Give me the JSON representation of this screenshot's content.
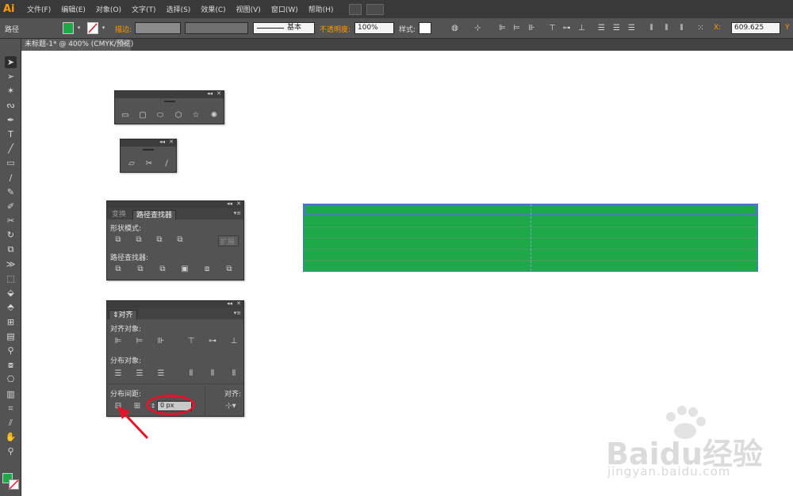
{
  "app": {
    "logo": "Ai"
  },
  "menu": [
    "文件(F)",
    "编辑(E)",
    "对象(O)",
    "文字(T)",
    "选择(S)",
    "效果(C)",
    "视图(V)",
    "窗口(W)",
    "帮助(H)"
  ],
  "control_bar": {
    "selection_label": "路径",
    "fill_color": "#1fa847",
    "stroke_label": "描边:",
    "stroke_profile": "基本",
    "opacity_label": "不透明度:",
    "opacity_value": "100%",
    "style_label": "样式:",
    "x_label": "X:",
    "x_value": "609.625"
  },
  "document_tab": {
    "title": "未标题-1* @ 400% (CMYK/预览)",
    "close": "×"
  },
  "panels": {
    "pathfinder": {
      "tabs": [
        "变换",
        "路径查找器"
      ],
      "shape_modes_label": "形状模式:",
      "expand_label": "扩展",
      "pathfinders_label": "路径查找器:"
    },
    "align": {
      "title": "对齐",
      "align_objects_label": "对齐对象:",
      "distribute_objects_label": "分布对象:",
      "distribute_spacing_label": "分布间距:",
      "align_to_label": "对齐:",
      "spacing_value": "0 px"
    }
  },
  "watermark": {
    "text": "Baidu经验",
    "url": "jingyan.baidu.com"
  },
  "colors": {
    "accent_orange": "#ff9a00",
    "object_green": "#1fa847",
    "selection_blue": "#4a77c9",
    "annotation_red": "#e3142b"
  }
}
